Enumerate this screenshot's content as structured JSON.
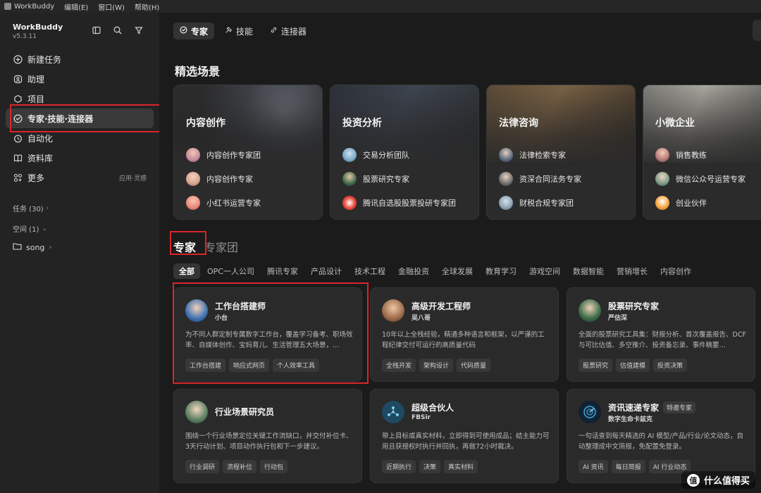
{
  "menubar": {
    "app_name": "WorkBuddy",
    "menus": [
      "编辑(E)",
      "窗口(W)",
      "帮助(H)"
    ]
  },
  "sidebar": {
    "brand": "WorkBuddy",
    "version": "v5.3.11",
    "nav": [
      {
        "label": "新建任务",
        "icon": "plus-circle-icon"
      },
      {
        "label": "助理",
        "icon": "assistant-icon"
      },
      {
        "label": "项目",
        "icon": "project-icon"
      },
      {
        "label": "专家·技能·连接器",
        "icon": "expert-icon"
      },
      {
        "label": "自动化",
        "icon": "clock-icon"
      },
      {
        "label": "资料库",
        "icon": "book-icon"
      },
      {
        "label": "更多",
        "icon": "grid-icon",
        "extra": "应用·灵感"
      }
    ],
    "sections": {
      "tasks": "任务 (30)",
      "spaces": "空间 (1)",
      "folder": "song"
    }
  },
  "topnav": {
    "tabs": [
      "专家",
      "技能",
      "连接器"
    ]
  },
  "featured": {
    "heading": "精选场景",
    "scenes": [
      {
        "title": "内容创作",
        "items": [
          "内容创作专家团",
          "内容创作专家",
          "小红书运营专家"
        ]
      },
      {
        "title": "投资分析",
        "items": [
          "交易分析团队",
          "股票研究专家",
          "腾讯自选股股票投研专家团"
        ]
      },
      {
        "title": "法律咨询",
        "items": [
          "法律检索专家",
          "资深合同法务专家",
          "财税合规专家团"
        ]
      },
      {
        "title": "小微企业",
        "items": [
          "销售教练",
          "微信公众号运营专家",
          "创业伙伴"
        ]
      }
    ]
  },
  "experts": {
    "tab_active": "专家",
    "tab_other": "专家团",
    "categories": [
      "全部",
      "OPC一人公司",
      "腾讯专家",
      "产品设计",
      "技术工程",
      "金融投资",
      "全球发展",
      "教育学习",
      "游戏空间",
      "数据智能",
      "营销增长",
      "内容创作"
    ],
    "cards": [
      {
        "title": "工作台搭建师",
        "subtitle": "小台",
        "desc": "为不同人群定制专属数字工作台，覆盖学习备考、职场效率、自媒体创作、宝妈育儿、生活管理五大场景，…",
        "tags": [
          "工作台搭建",
          "响应式网页",
          "个人效率工具"
        ]
      },
      {
        "title": "高级开发工程师",
        "subtitle": "吴八哥",
        "desc": "10年以上全栈经验，精通多种语言和框架，以严谨的工程纪律交付可运行的高质量代码",
        "tags": [
          "全栈开发",
          "架构设计",
          "代码质量"
        ]
      },
      {
        "title": "股票研究专家",
        "subtitle": "严估深",
        "desc": "全面的股票研究工具集：财报分析、首次覆盖报告、DCF与可比估值、多空推介、投资备忘录、事件稿要…",
        "tags": [
          "股票研究",
          "估值建模",
          "投资决策"
        ]
      },
      {
        "title": "行业场景研究员",
        "subtitle": "",
        "desc": "围绕一个行业场景定位关键工作流缺口，并交付补位卡、3天行动计划、项目动作执行包和下一步建议。",
        "tags": [
          "行业调研",
          "流程补位",
          "行动包"
        ]
      },
      {
        "title": "超级合伙人",
        "subtitle": "FBSir",
        "desc": "带上目标或真实材料，立即得到可使用成品；结主能力可用且获授权时执行并回执，再做72小时裁决。",
        "tags": [
          "近期执行",
          "决策",
          "真实材料"
        ]
      },
      {
        "title": "资讯速递专家",
        "badge": "特邀专家",
        "subtitle": "数字生命卡兹克",
        "desc": "一句话查到每天精选的 AI 模型/产品/行业/论文动态，自动整理成中文简报，免配置免登录。",
        "tags": [
          "AI 资讯",
          "每日简报",
          "AI 行业动态"
        ]
      }
    ]
  },
  "watermark": "什么值得买",
  "colors": {
    "highlight": "#d8262a",
    "background": "#1b1b1b",
    "card": "#2a2a2a"
  }
}
